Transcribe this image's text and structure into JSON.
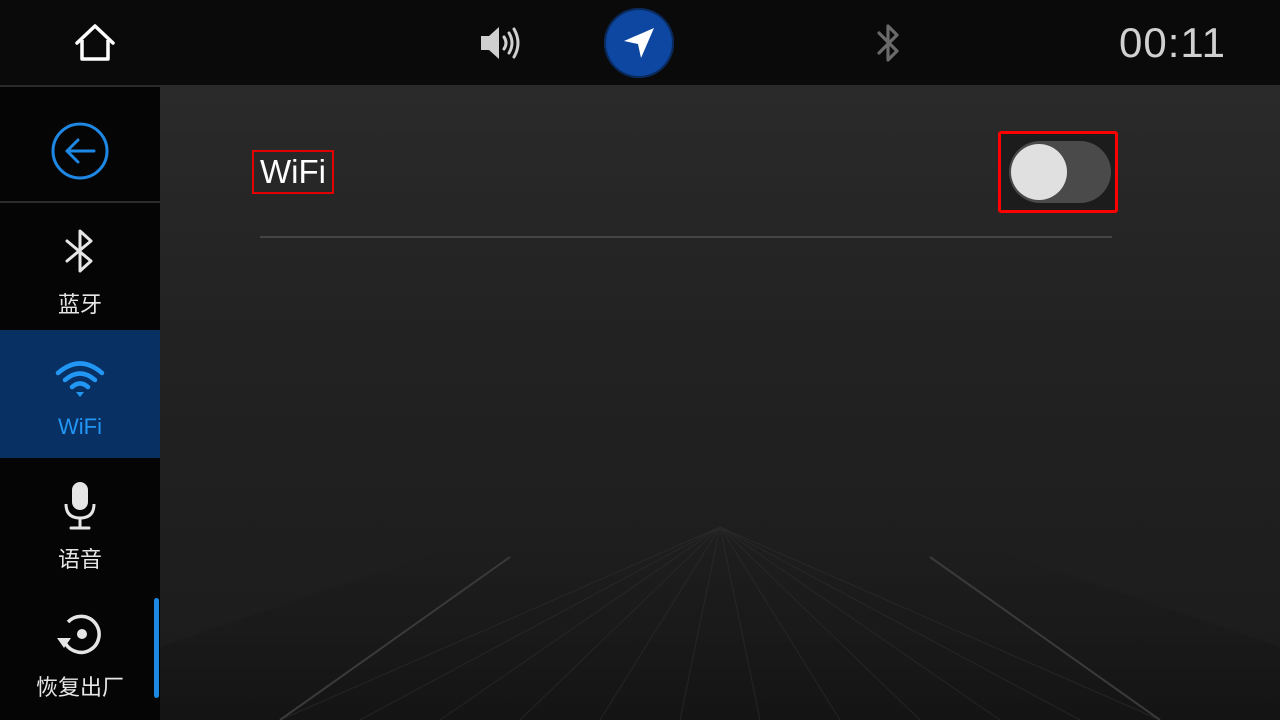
{
  "status_bar": {
    "clock": "00:11",
    "icons": {
      "home": "home-icon",
      "volume": "volume-icon",
      "navigation": "navigation-arrow-icon",
      "bluetooth_status": "bluetooth-icon"
    }
  },
  "sidebar": {
    "back_icon": "back-arrow-icon",
    "items": [
      {
        "label": "蓝牙",
        "icon": "bluetooth-icon",
        "active": false
      },
      {
        "label": "WiFi",
        "icon": "wifi-icon",
        "active": true
      },
      {
        "label": "语音",
        "icon": "microphone-icon",
        "active": false
      },
      {
        "label": "恢复出厂",
        "icon": "factory-reset-icon",
        "active": false
      }
    ]
  },
  "main": {
    "wifi_label": "WiFi",
    "wifi_toggle_on": false
  },
  "colors": {
    "accent": "#2196f3",
    "active_bg": "#083063",
    "nav_circle": "#0d47a1",
    "highlight": "#ff0000"
  }
}
